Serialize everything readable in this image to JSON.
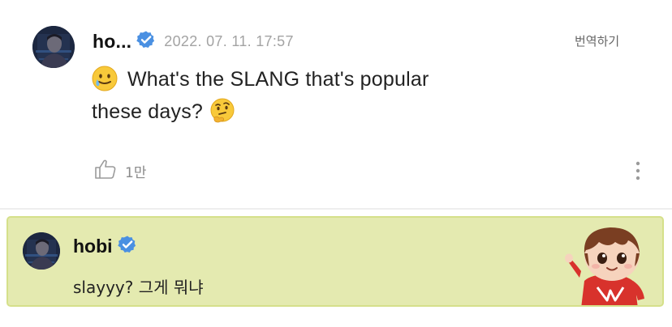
{
  "post": {
    "author_name": "ho...",
    "date": "2022. 07. 11. 17:57",
    "translate_label": "번역하기",
    "body_line1": "What's the SLANG that's popular",
    "body_line2": "these days?",
    "leading_emoji": "sweat-smile-emoji",
    "trailing_emoji": "thinking-face-emoji",
    "like_count": "1만"
  },
  "reply": {
    "author_name": "hobi",
    "text": "slayyy? 그게 뭐냐",
    "sticker": "waving-character-sticker"
  },
  "colors": {
    "verified_badge": "#4a90e2",
    "reply_background": "#e4eab0",
    "reply_border": "#d5e08a",
    "date_text": "#a3a3a3"
  }
}
